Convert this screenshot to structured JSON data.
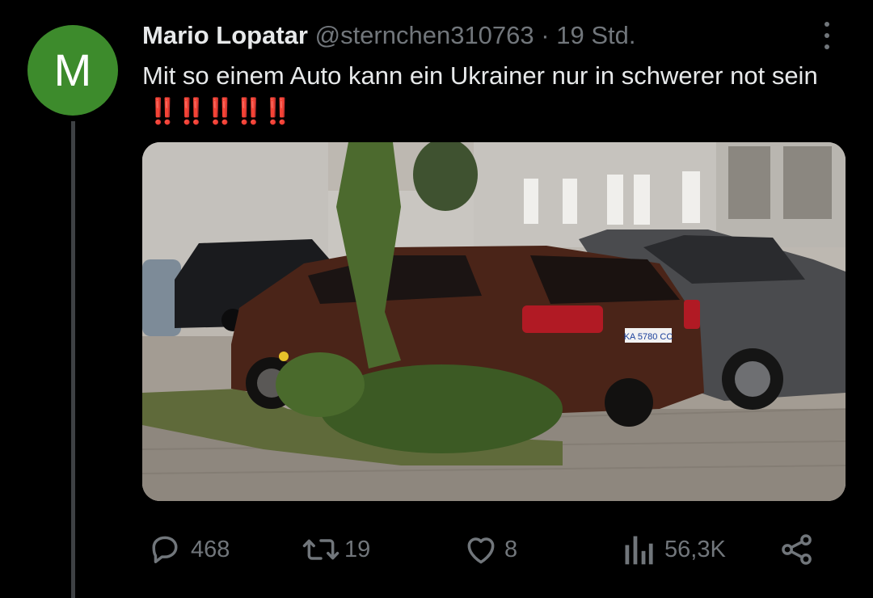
{
  "author": {
    "avatar_letter": "M",
    "avatar_color": "#3d8b2c",
    "name": "Mario Lopatar",
    "handle": "@sternchen310763",
    "separator": "·",
    "time": "19 Std."
  },
  "tweet": {
    "text": "Mit so einem Auto kann ein Ukrainer nur in schwerer not sein",
    "emoji": "‼️‼️‼️‼️‼️",
    "emoji_color": "#e8102b"
  },
  "media": {
    "plate_text": "KA 5780 CC"
  },
  "actions": {
    "reply": {
      "icon": "reply-icon",
      "count": "468"
    },
    "retweet": {
      "icon": "retweet-icon",
      "count": "19"
    },
    "like": {
      "icon": "heart-icon",
      "count": "8"
    },
    "views": {
      "icon": "views-icon",
      "count": "56,3K"
    },
    "share": {
      "icon": "share-icon"
    }
  },
  "colors": {
    "background": "#000000",
    "text_primary": "#e7e9ea",
    "text_secondary": "#71767b"
  }
}
